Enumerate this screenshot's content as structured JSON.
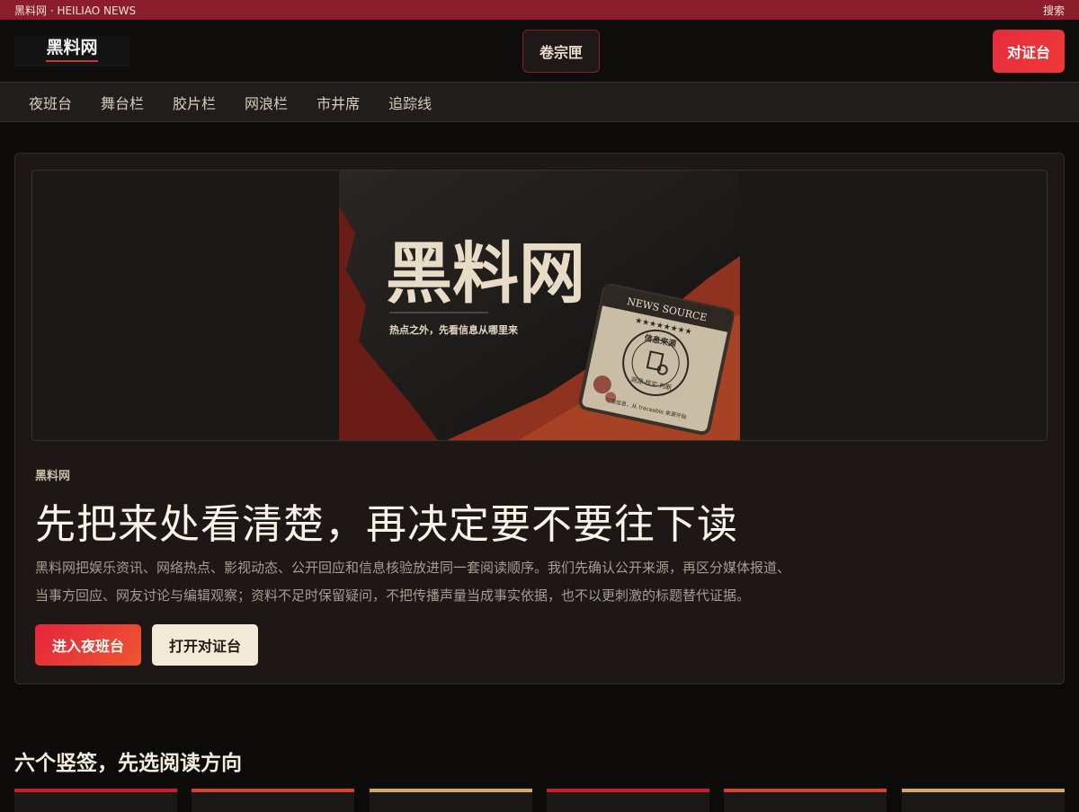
{
  "topbar": {
    "site_name": "黑料网 · HEILIAO NEWS",
    "search_label": "搜索"
  },
  "header": {
    "logo_text": "黑料网",
    "archive_button": "卷宗匣",
    "evidence_button": "对证台"
  },
  "nav": {
    "items": [
      {
        "label": "夜班台"
      },
      {
        "label": "舞台栏"
      },
      {
        "label": "胶片栏"
      },
      {
        "label": "网浪栏"
      },
      {
        "label": "市井席"
      },
      {
        "label": "追踪线"
      }
    ]
  },
  "banner": {
    "title": "黑料网",
    "tagline": "热点之外，先看信息从哪里来",
    "card_title": "NEWS SOURCE",
    "stamp_text": "信息来源",
    "stamp_sub": "溯源·核实·判断",
    "card_foot": "可靠信息，从 traceable 来源开始"
  },
  "hero": {
    "kicker": "黑料网",
    "headline": "先把来处看清楚，再决定要不要往下读",
    "desc_line1": "黑料网把娱乐资讯、网络热点、影视动态、公开回应和信息核验放进同一套阅读顺序。我们先确认公开来源，再区分媒体报道、",
    "desc_line2": "当事方回应、网友讨论与编辑观察；资料不足时保留疑问，不把传播声量当成事实依据，也不以更刺激的标题替代证据。",
    "primary_button": "进入夜班台",
    "secondary_button": "打开对证台"
  },
  "section": {
    "title": "六个竖签，先选阅读方向"
  },
  "colors": {
    "topbar": "#8c1d2c",
    "accent_red": "#e72a3f",
    "cream": "#f4ead8",
    "card_bars": [
      "#c81f2e",
      "#d2442d",
      "#d8a85a",
      "#c81f2e",
      "#d2442d",
      "#d8a85a"
    ]
  }
}
